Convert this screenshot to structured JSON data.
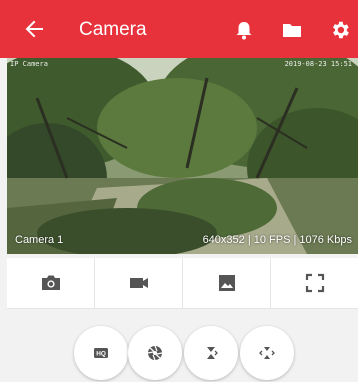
{
  "appbar": {
    "title": "Camera",
    "back_icon": "arrow-left-icon",
    "actions": [
      "bell-icon",
      "folder-icon",
      "gear-icon"
    ],
    "color": "#e8323b"
  },
  "video": {
    "osd_name": "IP Camera",
    "osd_timestamp": "2019-08-23 15:51",
    "camera_name": "Camera 1",
    "stats": "640x352 | 10 FPS | 1076 Kbps"
  },
  "toolbar": {
    "items": [
      "camera-icon",
      "video-camera-icon",
      "image-icon",
      "fullscreen-icon"
    ]
  },
  "fabs": {
    "hq_label": "HQ",
    "items": [
      "hq-icon",
      "aperture-icon",
      "zoom-in-icon",
      "zoom-out-icon"
    ]
  }
}
